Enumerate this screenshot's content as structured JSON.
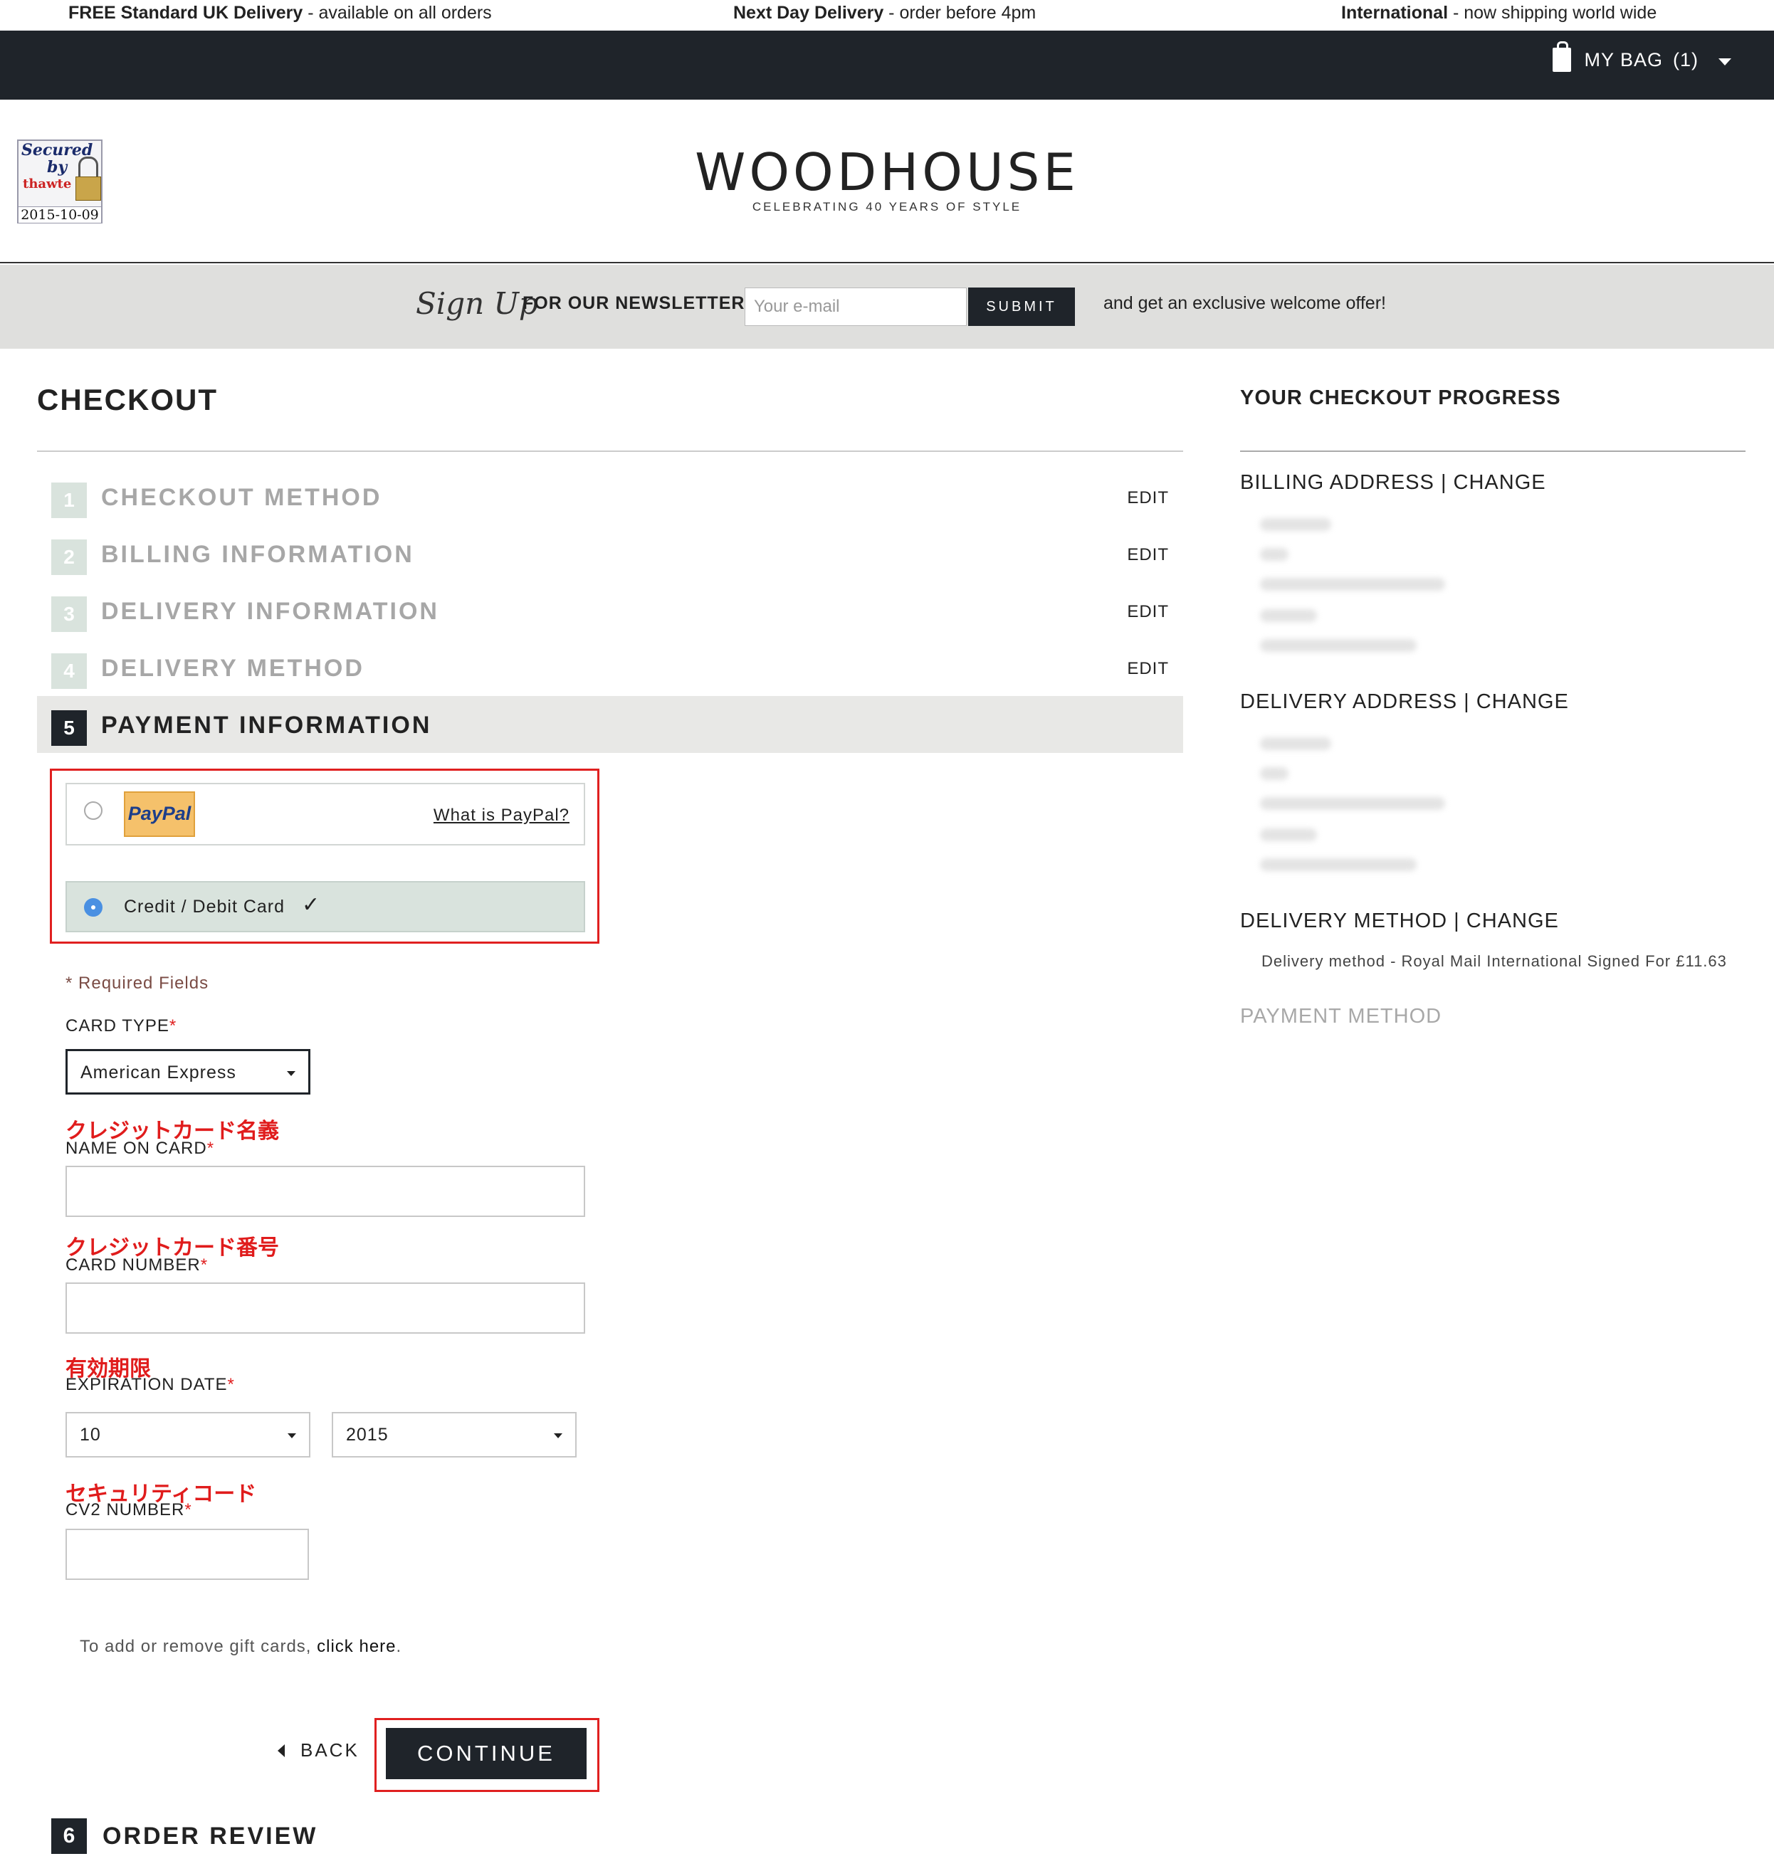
{
  "promo": {
    "free_bold": "FREE Standard UK Delivery",
    "free_rest": " - available on all orders",
    "next_bold": "Next Day Delivery",
    "next_rest": " - order before 4pm",
    "intl_bold": "International",
    "intl_rest": " - now shipping world wide"
  },
  "header": {
    "bag_label": "MY BAG",
    "bag_count": "(1)",
    "logo": "WOODHOUSE",
    "tagline": "CELEBRATING 40 YEARS OF STYLE",
    "badge": {
      "line1": "Secured",
      "line2": "by",
      "line3": "thawte",
      "date": "2015-10-09"
    }
  },
  "newsletter": {
    "signup": "Sign Up",
    "label": "FOR OUR NEWSLETTER",
    "placeholder": "Your e-mail",
    "submit": "SUBMIT",
    "tail": "and get an exclusive welcome offer!"
  },
  "checkout": {
    "title": "CHECKOUT",
    "steps": [
      {
        "num": "1",
        "label": "CHECKOUT METHOD",
        "edit": "EDIT"
      },
      {
        "num": "2",
        "label": "BILLING INFORMATION",
        "edit": "EDIT"
      },
      {
        "num": "3",
        "label": "DELIVERY INFORMATION",
        "edit": "EDIT"
      },
      {
        "num": "4",
        "label": "DELIVERY METHOD",
        "edit": "EDIT"
      },
      {
        "num": "5",
        "label": "PAYMENT INFORMATION"
      },
      {
        "num": "6",
        "label": "ORDER REVIEW"
      }
    ],
    "paypal": {
      "logo": "PayPal",
      "link": "What is PayPal?",
      "selected": false
    },
    "card_option": {
      "label": "Credit / Debit Card",
      "check": "✓",
      "selected": true
    },
    "required_note": "* Required Fields",
    "card_type": {
      "label": "CARD TYPE",
      "value": "American Express"
    },
    "name_on_card": {
      "jp": "クレジットカード名義",
      "label": "NAME ON CARD",
      "value": ""
    },
    "card_number": {
      "jp": "クレジットカード番号",
      "label": "CARD NUMBER",
      "value": ""
    },
    "expiration": {
      "jp": "有効期限",
      "label": "EXPIRATION DATE",
      "month": "10",
      "year": "2015"
    },
    "cv2": {
      "jp": "セキュリティコード",
      "label": "CV2 NUMBER",
      "value": ""
    },
    "star": "*",
    "gift_text": "To add or remove gift cards, ",
    "gift_link": "click here",
    "gift_end": ".",
    "back": "BACK",
    "continue": "CONTINUE"
  },
  "progress": {
    "title": "YOUR CHECKOUT PROGRESS",
    "billing": "BILLING ADDRESS",
    "delivery_address": "DELIVERY ADDRESS",
    "delivery_method": "DELIVERY METHOD",
    "change": "CHANGE",
    "separator": "|",
    "delivery_method_text": "Delivery method - Royal Mail International Signed For £11.63",
    "payment_method": "PAYMENT METHOD"
  }
}
